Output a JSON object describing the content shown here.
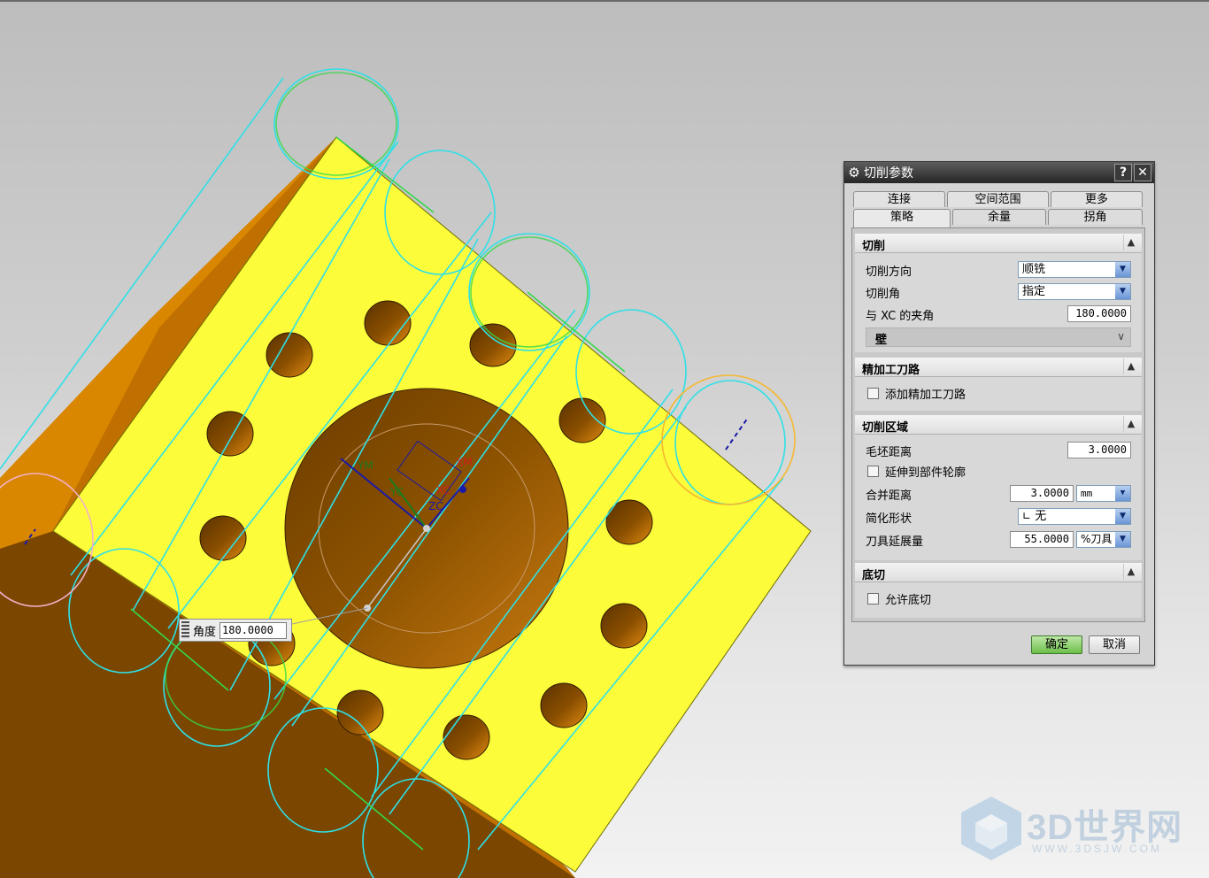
{
  "viewport": {
    "axis_labels": {
      "ym": "YM",
      "yc": "YC",
      "xm": "XM",
      "xc": "XC",
      "zc": "ZC"
    },
    "colors": {
      "part_top": "#fcfc3a",
      "part_side": "#c57200",
      "toolpath": "#2fe0e6",
      "toolpath_alt": "#34d94a",
      "bg": "#d0d0d0"
    }
  },
  "angle_popup": {
    "label": "角度",
    "value": "180.0000"
  },
  "dialog": {
    "title": "切削参数",
    "help_label": "?",
    "close_label": "✕",
    "tabs_back": [
      "连接",
      "空间范围",
      "更多"
    ],
    "tabs_front": [
      "策略",
      "余量",
      "拐角"
    ],
    "active_tab": "策略",
    "sections": {
      "cutting": {
        "title": "切削",
        "direction_label": "切削方向",
        "direction_value": "顺铣",
        "angle_label": "切削角",
        "angle_value": "指定",
        "xc_label": "与 XC 的夹角",
        "xc_value": "180.0000",
        "wall_label": "壁"
      },
      "finish": {
        "title": "精加工刀路",
        "add_label": "添加精加工刀路"
      },
      "region": {
        "title": "切削区域",
        "blank_label": "毛坯距离",
        "blank_value": "3.0000",
        "extend_label": "延伸到部件轮廓",
        "merge_label": "合并距离",
        "merge_value": "3.0000",
        "merge_unit": "mm",
        "simplify_label": "简化形状",
        "simplify_value": "无",
        "tool_ext_label": "刀具延展量",
        "tool_ext_value": "55.0000",
        "tool_ext_unit": "%刀具"
      },
      "undercut": {
        "title": "底切",
        "allow_label": "允许底切"
      }
    },
    "ok_label": "确定",
    "cancel_label": "取消"
  },
  "watermark": {
    "brand": "3D世界网",
    "url": "WWW.3DSJW.COM"
  }
}
